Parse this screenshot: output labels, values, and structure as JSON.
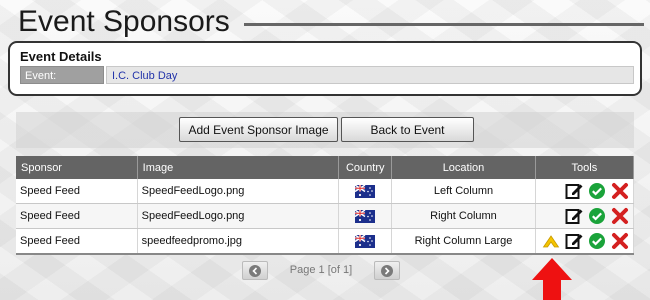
{
  "page": {
    "title": "Event Sponsors"
  },
  "event_details": {
    "heading": "Event Details",
    "label": "Event:",
    "value": "I.C. Club Day"
  },
  "toolbar": {
    "add_label": "Add Event Sponsor Image",
    "back_label": "Back to Event"
  },
  "table": {
    "headers": {
      "sponsor": "Sponsor",
      "image": "Image",
      "country": "Country",
      "location": "Location",
      "tools": "Tools"
    },
    "rows": [
      {
        "sponsor": "Speed Feed",
        "image": "SpeedFeedLogo.png",
        "country_icon": "australia-flag-icon",
        "location": "Left Column",
        "tools": [
          "edit-icon",
          "approve-icon",
          "delete-icon"
        ]
      },
      {
        "sponsor": "Speed Feed",
        "image": "SpeedFeedLogo.png",
        "country_icon": "australia-flag-icon",
        "location": "Right Column",
        "tools": [
          "edit-icon",
          "approve-icon",
          "delete-icon"
        ]
      },
      {
        "sponsor": "Speed Feed",
        "image": "speedfeedpromo.jpg",
        "country_icon": "australia-flag-icon",
        "location": "Right Column Large",
        "tools": [
          "move-up-icon",
          "edit-icon",
          "approve-icon",
          "delete-icon"
        ]
      }
    ]
  },
  "pager": {
    "text": "Page 1 [of 1]"
  },
  "colors": {
    "header_bg": "#646464",
    "edit": "#111111",
    "approve": "#1aa33a",
    "delete": "#d42020",
    "move_up": "#f5c400",
    "callout": "#ee1111"
  }
}
